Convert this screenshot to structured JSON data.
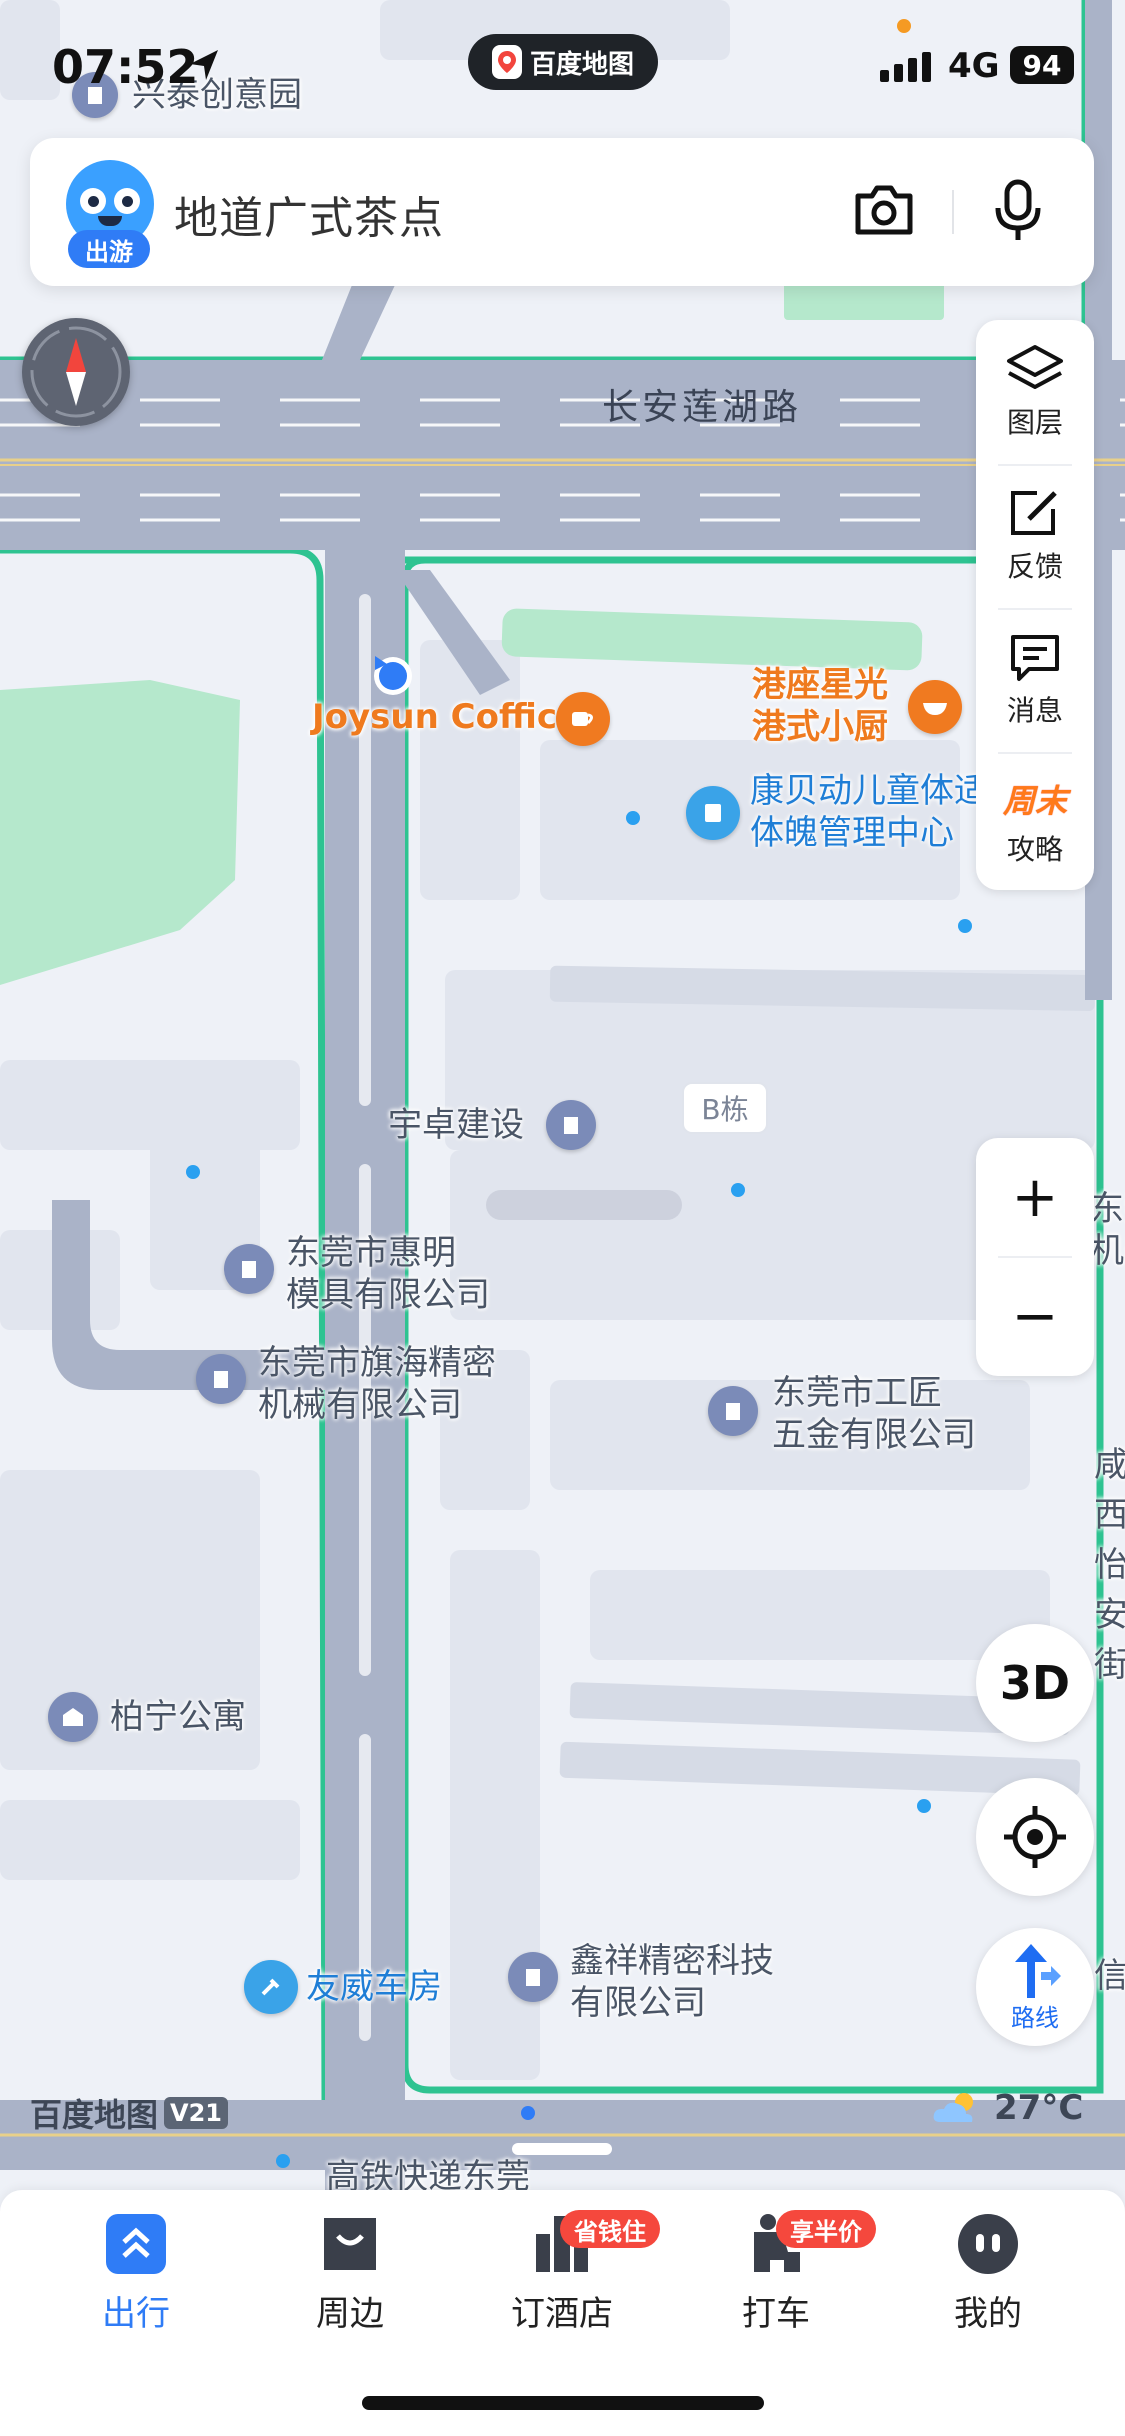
{
  "status_bar": {
    "time": "07:52",
    "network": "4G",
    "battery": "94"
  },
  "app_pill": {
    "label": "百度地图"
  },
  "search": {
    "badge": "出游",
    "query": "地道广式茶点"
  },
  "side_panel": {
    "items": [
      {
        "label": "图层",
        "icon": "layers-icon"
      },
      {
        "label": "反馈",
        "icon": "edit-icon"
      },
      {
        "label": "消息",
        "icon": "message-icon"
      },
      {
        "label": "攻略",
        "icon": "weekend-badge-icon",
        "badge": "周末"
      }
    ]
  },
  "controls": {
    "zoom_in": "+",
    "zoom_out": "−",
    "three_d": "3D",
    "route": "路线"
  },
  "map": {
    "roads": {
      "main": "长安莲湖路"
    },
    "pois": {
      "xingtai": "兴泰创意园",
      "joysun": "Joysun Coffice",
      "gangzuo_1": "港座星光",
      "gangzuo_2": "港式小厨",
      "kangbei_1": "康贝动儿童体适",
      "kangbei_2": "体魄管理中心",
      "yuzhuo": "宇卓建设",
      "building_b": "B栋",
      "huiming_1": "东莞市惠明",
      "huiming_2": "模具有限公司",
      "qihai_1": "东莞市旗海精密",
      "qihai_2": "机械有限公司",
      "gongjiang_1": "东莞市工匠",
      "gongjiang_2": "五金有限公司",
      "boning": "柏宁公寓",
      "youwei": "友威车房",
      "xinxiang_1": "鑫祥精密科技",
      "xinxiang_2": "有限公司",
      "gaotie": "高铁快递东莞",
      "edge_right_1": "东莞",
      "edge_right_2": "机器",
      "edge_right_col": "咸西怡安街",
      "edge_right_xin": "信"
    },
    "scale_text": "百度地图",
    "scale_version": "V21",
    "weather": "27°C"
  },
  "tabbar": {
    "tabs": [
      {
        "label": "出行",
        "active": true
      },
      {
        "label": "周边"
      },
      {
        "label": "订酒店",
        "badge": "省钱住"
      },
      {
        "label": "打车",
        "badge": "享半价"
      },
      {
        "label": "我的"
      }
    ]
  },
  "colors": {
    "accent": "#2f7cf6",
    "road_fill": "#aab3c8",
    "road_edge": "#2ec391",
    "park": "#b5e8cc",
    "badge_red": "#f5483d",
    "poi_orange": "#f07a20"
  }
}
